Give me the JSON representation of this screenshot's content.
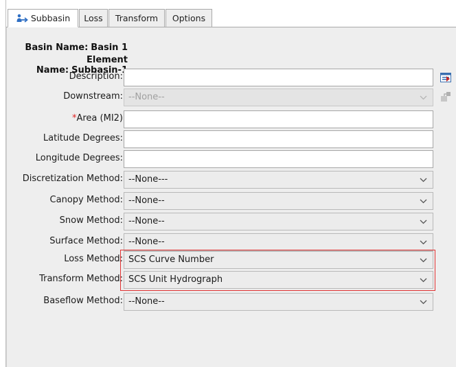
{
  "tabs": [
    {
      "label": "Subbasin",
      "active": true
    },
    {
      "label": "Loss",
      "active": false
    },
    {
      "label": "Transform",
      "active": false
    },
    {
      "label": "Options",
      "active": false
    }
  ],
  "info": {
    "basin_label": "Basin Name:",
    "basin_value": "Basin 1",
    "element_label": "Element Name:",
    "element_value": "Subbasin-1"
  },
  "fields": {
    "description": {
      "label": "Description:",
      "value": ""
    },
    "downstream": {
      "label": "Downstream:",
      "value": "--None--"
    },
    "area": {
      "required_mark": "*",
      "label": "Area (MI2)",
      "value": ""
    },
    "latitude": {
      "label": "Latitude Degrees:",
      "value": ""
    },
    "longitude": {
      "label": "Longitude Degrees:",
      "value": ""
    },
    "discretization": {
      "label": "Discretization Method:",
      "value": "--None---"
    },
    "canopy": {
      "label": "Canopy Method:",
      "value": "--None--"
    },
    "snow": {
      "label": "Snow Method:",
      "value": "--None--"
    },
    "surface": {
      "label": "Surface Method:",
      "value": "--None--"
    },
    "loss": {
      "label": "Loss Method:",
      "value": "SCS Curve Number"
    },
    "transform": {
      "label": "Transform Method:",
      "value": "SCS Unit Hydrograph"
    },
    "baseflow": {
      "label": "Baseflow Method:",
      "value": "--None--"
    }
  },
  "colors": {
    "highlight": "#e03030",
    "required": "#e02020",
    "panel_bg": "#eeeeee"
  },
  "icons": {
    "subbasin_tab": "subbasin-icon",
    "description_side": "edit-description-icon",
    "downstream_side": "select-downstream-icon",
    "dropdown": "chevron-down-icon"
  }
}
